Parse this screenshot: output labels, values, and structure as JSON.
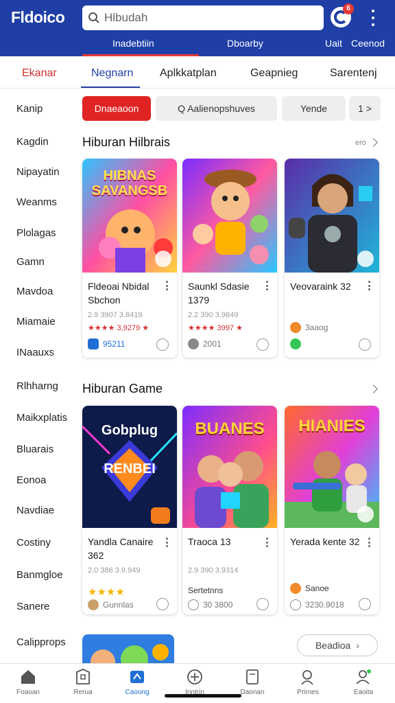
{
  "app": {
    "logo": "Fldoico"
  },
  "search": {
    "value": "Hlbudah"
  },
  "header": {
    "notif_count": "6",
    "links": [
      "Inadebtiin",
      "Dboarby",
      "Uait",
      "Ceenod"
    ]
  },
  "tabs": [
    "Ekanar",
    "Negnarn",
    "Aplkkatplan",
    "Geapnieg",
    "Sarentenj"
  ],
  "sidebar": [
    "Kanip",
    "Kagdin",
    "Nipayatin",
    "Weanms",
    "Plolagas",
    "Gamn",
    "Mavdoa",
    "Miamaie",
    "INaauxs",
    "Rlhharng",
    "Maikxplatis",
    "Bluarais",
    "Eonoa",
    "Navdiae",
    "Costiny",
    "Banmgloe",
    "Sanere",
    "Calipprops"
  ],
  "chips": [
    "Dnaeaoon",
    "Q Aalienopshuves",
    "Yende",
    "1 >"
  ],
  "sections": [
    {
      "title": "Hiburan Hilbrais",
      "more": "ero",
      "cards": [
        {
          "thumb_text": "HIBNAS SAVANGSB",
          "name": "Fldeoai Nbidal Sbchon",
          "meta": "2.9 3907 3.8419",
          "rating": "★★★★ 3,9279 ★",
          "foot": "95211",
          "icon": "app-icon"
        },
        {
          "thumb_text": "",
          "name": "Saunkl Sdasie 1379",
          "meta": "2.2 390 3.9849",
          "rating": "★★★★ 3997 ★",
          "foot": "2001",
          "icon": "location-icon"
        },
        {
          "thumb_text": "",
          "name": "Veovaraink 32",
          "meta": "",
          "rating": "",
          "foot": "3aaog",
          "icon": "orange-dot-icon"
        }
      ]
    },
    {
      "title": "Hiburan Game",
      "more": "",
      "cards": [
        {
          "thumb_text": "Gobplug RENBEI",
          "name": "Yandla Canaire 362",
          "meta": "2.0 386 3.9.949",
          "rating": "★★★★",
          "foot": "Gunnlas",
          "icon": "dice-icon"
        },
        {
          "thumb_text": "BUANES",
          "name": "Traoca 13",
          "meta": "2.9 390 3.9314",
          "rating": "Sertetnns",
          "foot": "30 3800",
          "icon": "refresh-icon"
        },
        {
          "thumb_text": "HIANIES",
          "name": "Yerada kente 32",
          "meta": "",
          "rating": "Sanoe",
          "foot": "3230.9018",
          "icon": "clock-icon"
        }
      ]
    }
  ],
  "more_button": "Beadioa",
  "bottom_nav": [
    "Foaoan",
    "Rerua",
    "Caoong",
    "Inntrin",
    "Daonan",
    "Prirnes",
    "Eaoita"
  ],
  "colors": {
    "brand": "#1f3fa6",
    "accent": "#e02424",
    "active": "#1f6fd6"
  }
}
